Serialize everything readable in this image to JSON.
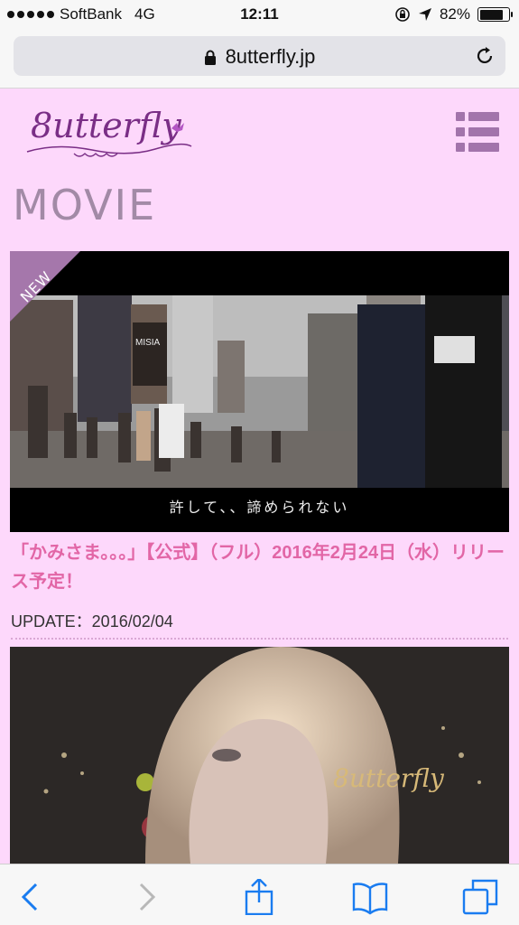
{
  "status_bar": {
    "carrier": "SoftBank",
    "network": "4G",
    "time": "12:11",
    "battery": "82%",
    "battery_level": 0.82
  },
  "browser": {
    "url": "8utterfly.jp"
  },
  "site": {
    "logo_text": "8utterfly",
    "page_title": "MOVIE",
    "accent_color": "#e266a6",
    "brand_color": "#7a2e86"
  },
  "movies": [
    {
      "badge": "NEW",
      "subtitle": "許して、、諦められない",
      "billboard_text": "MISIA",
      "title": "「かみさま。。。」【公式】（フル）2016年2月24日（水）リリース予定！",
      "update": "UPDATE：2016/02/04"
    },
    {
      "watermark": "8utterfly"
    }
  ]
}
